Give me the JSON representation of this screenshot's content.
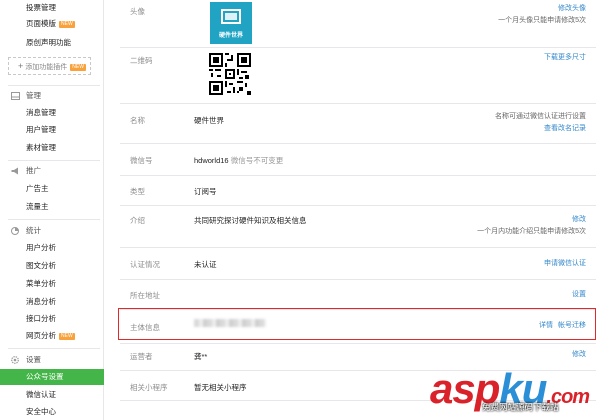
{
  "sidebar": {
    "top_items": [
      {
        "label": "投票管理",
        "tag": ""
      },
      {
        "label": "页面模版",
        "tag": "NEW"
      },
      {
        "label": "原创声明功能",
        "tag": ""
      }
    ],
    "add_plugin": {
      "plus": "+",
      "label": "添加功能插件",
      "tag": "NEW"
    },
    "sections": {
      "manage": {
        "title": "管理",
        "items": [
          "消息管理",
          "用户管理",
          "素材管理"
        ]
      },
      "promote": {
        "title": "推广",
        "items": [
          "广告主",
          "流量主"
        ]
      },
      "stats": {
        "title": "统计",
        "items": [
          "用户分析",
          "图文分析",
          "菜单分析",
          "消息分析",
          "接口分析",
          "网页分析"
        ],
        "new_on": "网页分析"
      },
      "settings": {
        "title": "设置",
        "items": [
          "公众号设置",
          "微信认证",
          "安全中心"
        ],
        "active": "公众号设置"
      }
    },
    "tag_new": "NEW"
  },
  "rows": {
    "avatar": {
      "label": "头像",
      "avatar_caption": "硬件世界",
      "action": "修改头像",
      "note": "一个月头像只能申请修改5次"
    },
    "qrcode": {
      "label": "二维码",
      "action": "下载更多尺寸"
    },
    "name": {
      "label": "名称",
      "value": "硬件世界",
      "note": "名称可通过微信认证进行设置",
      "action": "查看改名记录"
    },
    "wechat_id": {
      "label": "微信号",
      "value": "hdworld16",
      "value_note": "微信号不可变更"
    },
    "type": {
      "label": "类型",
      "value": "订阅号"
    },
    "intro": {
      "label": "介绍",
      "value": "共同研究探讨硬件知识及相关信息",
      "action": "修改",
      "note": "一个月内功能介绍只能申请修改5次"
    },
    "verify": {
      "label": "认证情况",
      "value": "未认证",
      "action": "申请微信认证"
    },
    "location": {
      "label": "所在地址",
      "action": "设置"
    },
    "subject": {
      "label": "主体信息",
      "action_detail": "详情",
      "action_migrate": "帐号迁移"
    },
    "operator": {
      "label": "运营者",
      "value": "龚**",
      "action": "修改"
    },
    "mini_program": {
      "label": "相关小程序",
      "value": "暂无相关小程序"
    }
  },
  "watermark": {
    "brand_a": "asp",
    "brand_b": "ku",
    "brand_c": ".com",
    "sub": "免费网站源码下载站"
  },
  "colors": {
    "accent": "#44b549",
    "link": "#3388cc",
    "highlight": "#e02a2a",
    "avatar_bg": "#21a3c4"
  }
}
